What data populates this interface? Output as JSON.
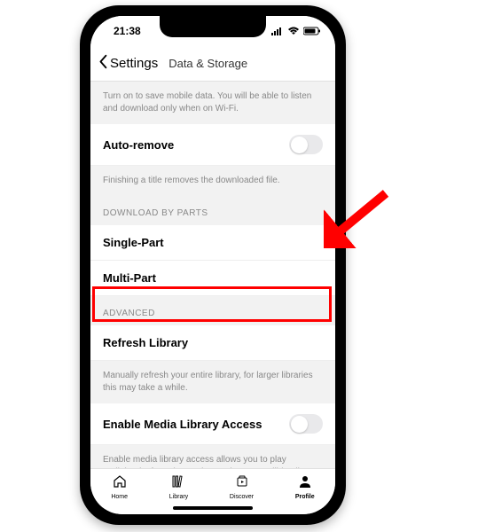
{
  "status": {
    "time": "21:38"
  },
  "nav": {
    "back": "Settings",
    "title": "Data & Storage"
  },
  "wifiDesc": "Turn on to save mobile data. You will be able to listen and download only when on Wi-Fi.",
  "autoRemove": {
    "label": "Auto-remove",
    "desc": "Finishing a title removes the downloaded file."
  },
  "sections": {
    "downloadByParts": "DOWNLOAD BY PARTS",
    "advanced": "ADVANCED"
  },
  "parts": {
    "single": "Single-Part",
    "multi": "Multi-Part"
  },
  "refresh": {
    "label": "Refresh Library",
    "desc": "Manually refresh your entire library, for larger libraries this may take a while."
  },
  "mediaAccess": {
    "label": "Enable Media Library Access",
    "desc": "Enable media library access allows you to play audiobooks from the Books app in your Audible Library"
  },
  "tabs": {
    "home": "Home",
    "library": "Library",
    "discover": "Discover",
    "profile": "Profile"
  }
}
